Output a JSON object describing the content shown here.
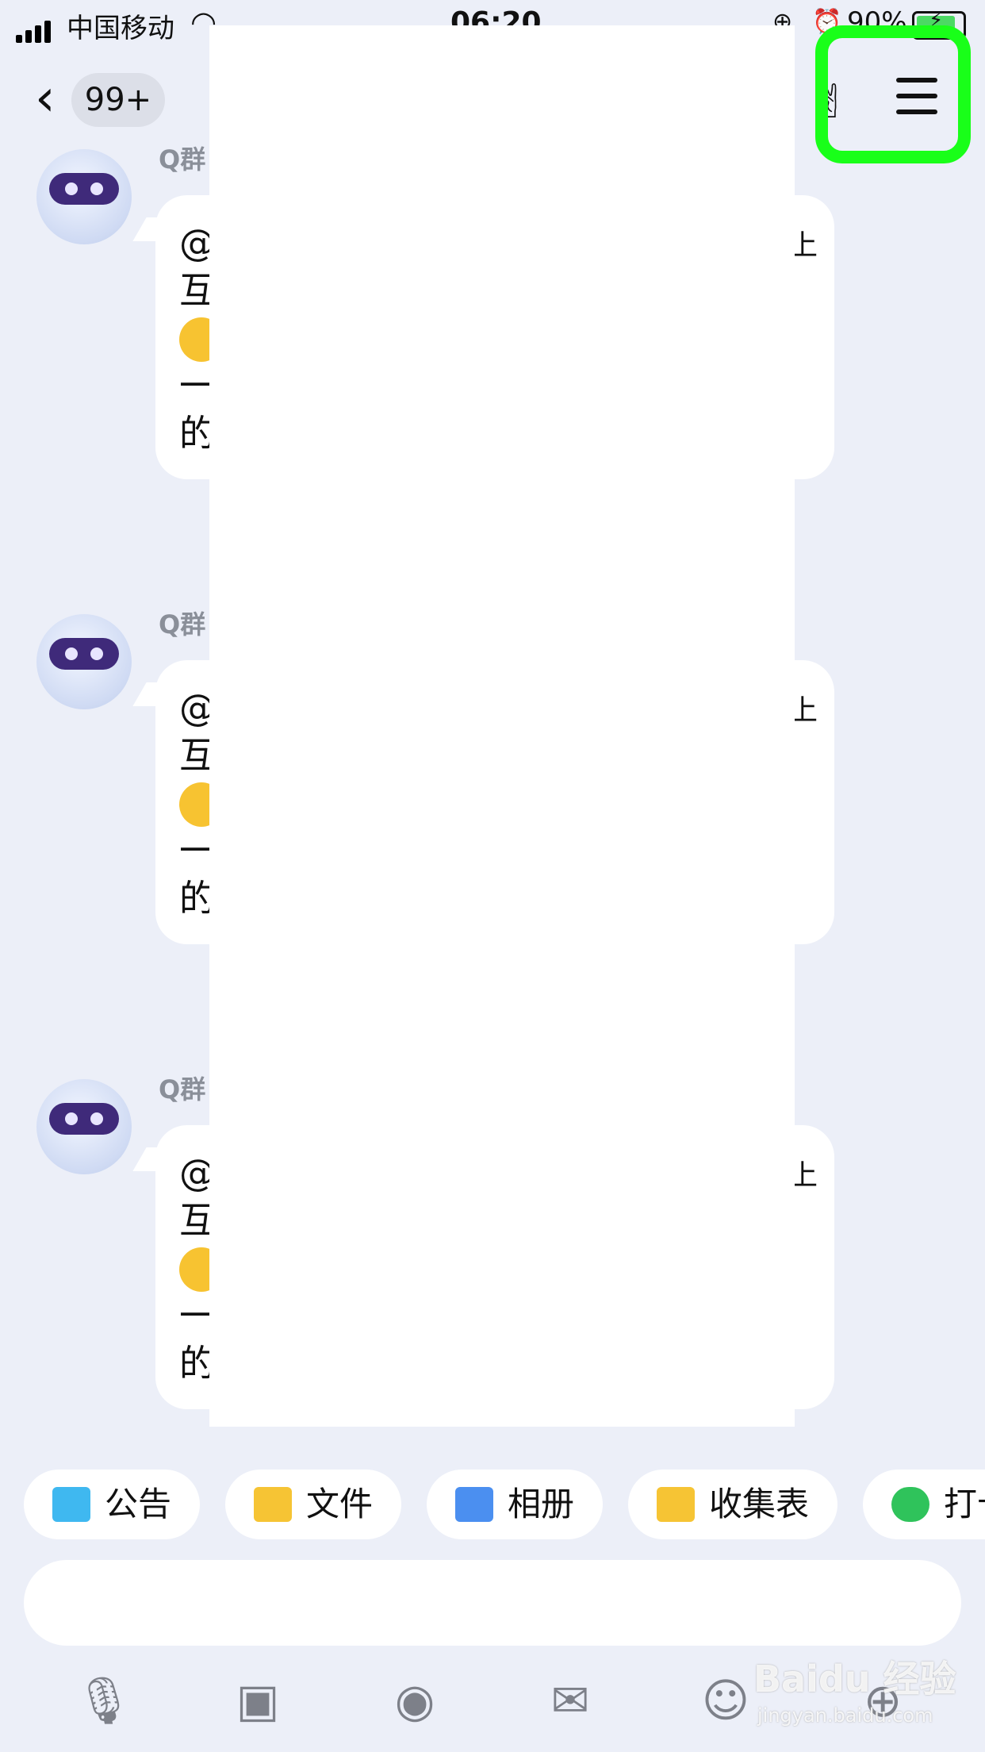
{
  "status_bar": {
    "carrier": "中国移动",
    "time": "06:20",
    "battery_percent": "90%",
    "battery_level": 0.9
  },
  "header": {
    "unread_count": "99+"
  },
  "messages": [
    {
      "sender": "Q群",
      "lines": [
        "@",
        "互",
        "",
        "一",
        "的"
      ],
      "edge_char": "上"
    },
    {
      "sender": "Q群",
      "lines": [
        "@",
        "互",
        "",
        "一",
        "的"
      ],
      "edge_char": "上"
    },
    {
      "sender": "Q群",
      "lines": [
        "@",
        "互",
        "",
        "一",
        "的"
      ],
      "edge_char": "上"
    }
  ],
  "tools": [
    {
      "label": "公告",
      "icon": "megaphone-icon",
      "color": "#3fb8f0"
    },
    {
      "label": "文件",
      "icon": "folder-icon",
      "color": "#f6c434"
    },
    {
      "label": "相册",
      "icon": "album-icon",
      "color": "#4b8ff0"
    },
    {
      "label": "收集表",
      "icon": "form-icon",
      "color": "#f6c434"
    },
    {
      "label": "打卡",
      "icon": "checkin-icon",
      "color": "#2fc35b"
    }
  ],
  "input": {
    "placeholder": ""
  },
  "bottom_icons": [
    "microphone-icon",
    "image-icon",
    "camera-icon",
    "red-envelope-icon",
    "emoji-icon",
    "plus-icon"
  ],
  "watermark": {
    "brand": "Baidu 经验",
    "url": "jingyan.baidu.com"
  }
}
